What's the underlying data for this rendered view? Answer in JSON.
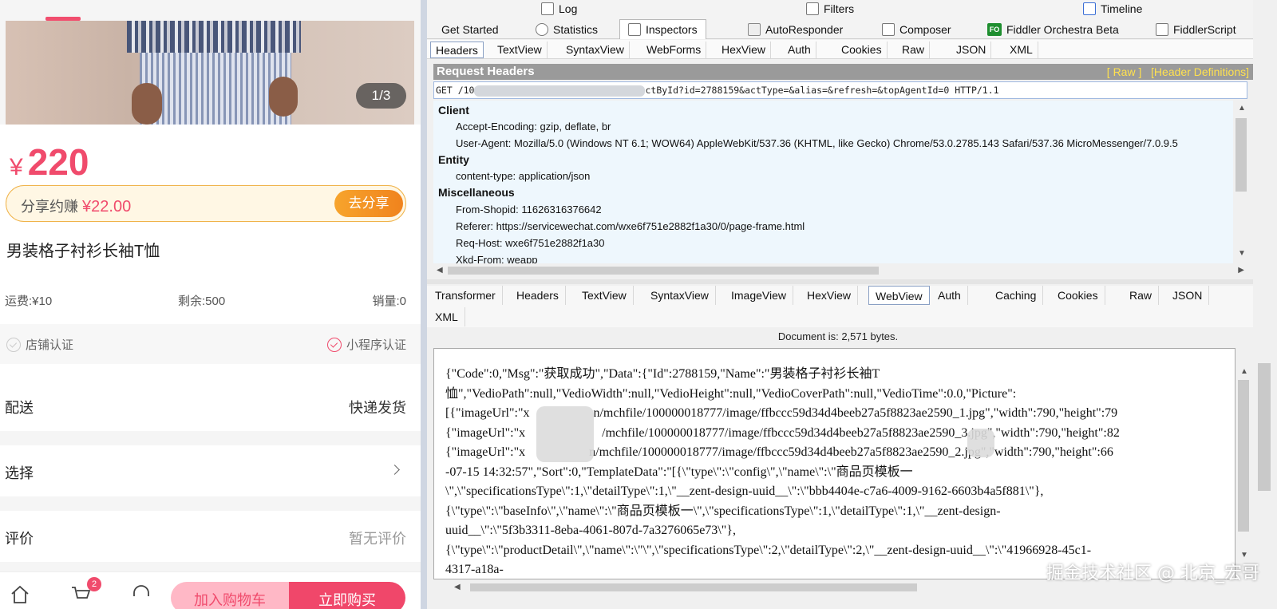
{
  "product": {
    "image_counter": "1/3",
    "price_symbol": "¥",
    "price": "220",
    "share_label": "分享约赚",
    "share_amount": "¥22.00",
    "share_button": "去分享",
    "title": "男装格子衬衫长袖T恤",
    "shipping": "运费:¥10",
    "stock": "剩余:500",
    "sales": "销量:0",
    "cert_shop": "店铺认证",
    "cert_miniapp": "小程序认证",
    "delivery_label": "配送",
    "delivery_value": "快递发货",
    "select_label": "选择",
    "review_label": "评价",
    "review_value": "暂无评价",
    "cart_badge": "2",
    "add_cart": "加入购物车",
    "buy_now": "立即购买"
  },
  "fiddler": {
    "top_tabs": [
      "Log",
      "Filters",
      "Timeline"
    ],
    "main_tabs": [
      "Get Started",
      "Statistics",
      "Inspectors",
      "AutoResponder",
      "Composer",
      "Fiddler Orchestra Beta",
      "FiddlerScript"
    ],
    "fo_badge": "FO",
    "request_tabs": [
      "Headers",
      "TextView",
      "SyntaxView",
      "WebForms",
      "HexView",
      "Auth",
      "Cookies",
      "Raw",
      "JSON",
      "XML"
    ],
    "request_headers_title": "Request Headers",
    "raw_link": "[ Raw ]",
    "header_defs_link": "[Header Definitions]",
    "request_line_start": "GET /10",
    "request_line_end": "ctById?id=2788159&actType=&alias=&refresh=&topAgentId=0 HTTP/1.1",
    "groups": {
      "client": "Client",
      "entity": "Entity",
      "misc": "Miscellaneous"
    },
    "headers": {
      "accept_encoding": "Accept-Encoding: gzip, deflate, br",
      "user_agent": "User-Agent: Mozilla/5.0 (Windows NT 6.1; WOW64) AppleWebKit/537.36 (KHTML, like Gecko) Chrome/53.0.2785.143 Safari/537.36 MicroMessenger/7.0.9.5",
      "content_type": "content-type: application/json",
      "from_shopid": "From-Shopid: 11626316376642",
      "referer": "Referer: https://servicewechat.com/wxe6f751e2882f1a30/0/page-frame.html",
      "req_host": "Req-Host: wxe6f751e2882f1a30",
      "xkd_from": "Xkd-From: weapp"
    },
    "response_tabs": [
      "Transformer",
      "Headers",
      "TextView",
      "SyntaxView",
      "ImageView",
      "HexView",
      "WebView",
      "Auth",
      "Caching",
      "Cookies",
      "Raw",
      "JSON",
      "XML"
    ],
    "document_size": "Document is: 2,571 bytes.",
    "body_lines": [
      "{\"Code\":0,\"Msg\":\"获取成功\",\"Data\":{\"Id\":2788159,\"Name\":\"男装格子衬衫长袖T",
      "恤\",\"VedioPath\":null,\"VedioWidth\":null,\"VedioHeight\":null,\"VedioCoverPath\":null,\"VedioTime\":0.0,\"Picture\":",
      "[{\"imageUrl\":\"x     n/mchfile/100000018777/image/ffbccc59d34d4beeb27a5f8823ae2590_1.jpg\",\"width\":790,\"height\":79",
      "{\"imageUrl\":\"x      /mchfile/100000018777/image/ffbccc59d34d4beeb27a5f8823ae2590_3.jpg\",\"width\":790,\"height\":82",
      "{\"imageUrl\":\"x     n/mchfile/100000018777/image/ffbccc59d34d4beeb27a5f8823ae2590_2.jpg\",\"width\":790,\"height\":66",
      "-07-15 14:32:57\",\"Sort\":0,\"TemplateData\":\"[{\\\"type\\\":\\\"config\\\",\\\"name\\\":\\\"商品页模板一",
      "\\\",\\\"specificationsType\\\":1,\\\"detailType\\\":1,\\\"__zent-design-uuid__\\\":\\\"bbb4404e-c7a6-4009-9162-6603b4a5f881\\\"},",
      "{\\\"type\\\":\\\"baseInfo\\\",\\\"name\\\":\\\"商品页模板一\\\",\\\"specificationsType\\\":1,\\\"detailType\\\":1,\\\"__zent-design-",
      "uuid__\\\":\\\"5f3b3311-8eba-4061-807d-7a3276065e73\\\"},",
      "{\\\"type\\\":\\\"productDetail\\\",\\\"name\\\":\\\"\\\",\\\"specificationsType\\\":2,\\\"detailType\\\":2,\\\"__zent-design-uuid__\\\":\\\"41966928-45c1-",
      "4317-a18a-"
    ]
  },
  "watermark": "掘金技术社区 @ 北京_宏哥"
}
